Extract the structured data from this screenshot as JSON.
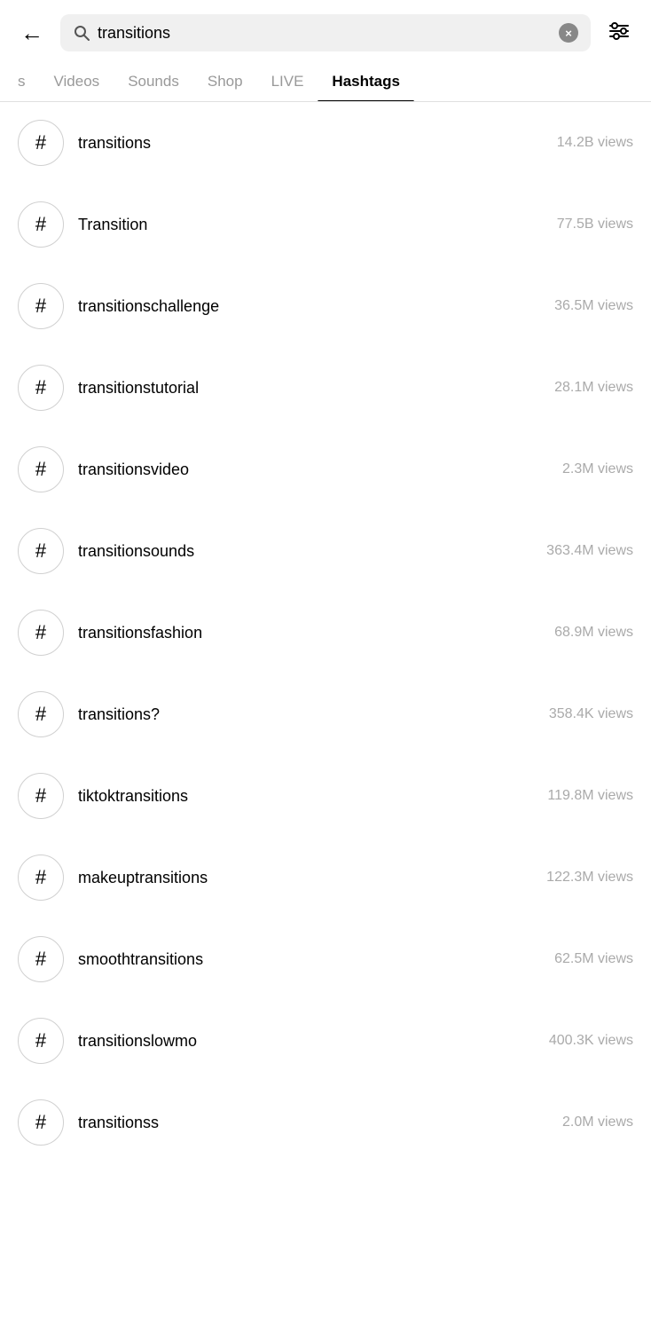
{
  "header": {
    "back_label": "←",
    "search_value": "transitions",
    "clear_label": "×",
    "filter_label": "filter"
  },
  "tabs": [
    {
      "id": "top",
      "label": "s",
      "active": false
    },
    {
      "id": "videos",
      "label": "Videos",
      "active": false
    },
    {
      "id": "sounds",
      "label": "Sounds",
      "active": false
    },
    {
      "id": "shop",
      "label": "Shop",
      "active": false
    },
    {
      "id": "live",
      "label": "LIVE",
      "active": false
    },
    {
      "id": "hashtags",
      "label": "Hashtags",
      "active": true
    }
  ],
  "hashtags": [
    {
      "name": "transitions",
      "views": "14.2B views"
    },
    {
      "name": "Transition",
      "views": "77.5B views"
    },
    {
      "name": "transitionschallenge",
      "views": "36.5M views"
    },
    {
      "name": "transitionstutorial",
      "views": "28.1M views"
    },
    {
      "name": "transitionsvideo",
      "views": "2.3M views"
    },
    {
      "name": "transitionsounds",
      "views": "363.4M views"
    },
    {
      "name": "transitionsfashion",
      "views": "68.9M views"
    },
    {
      "name": "transitions?",
      "views": "358.4K views"
    },
    {
      "name": "tiktoktransitions",
      "views": "119.8M views"
    },
    {
      "name": "makeuptransitions",
      "views": "122.3M views"
    },
    {
      "name": "smoothtransitions",
      "views": "62.5M views"
    },
    {
      "name": "transitionslowmo",
      "views": "400.3K views"
    },
    {
      "name": "transitionss",
      "views": "2.0M views"
    }
  ]
}
